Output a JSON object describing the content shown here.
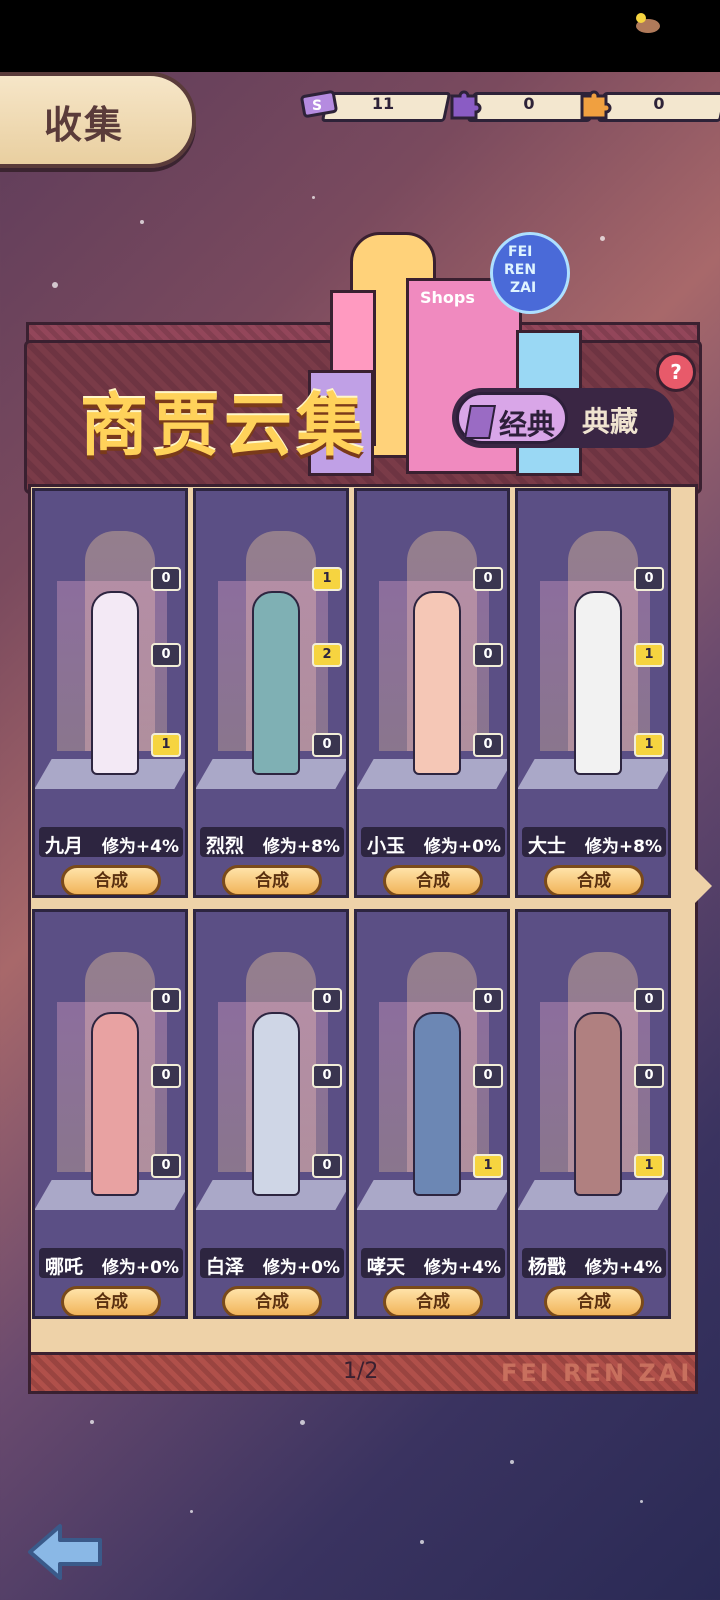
{
  "header": {
    "title": "收集",
    "currencies": [
      {
        "icon": "ticket-icon",
        "value": "11"
      },
      {
        "icon": "purple-puzzle-icon",
        "value": "0"
      },
      {
        "icon": "orange-puzzle-icon",
        "value": "0"
      }
    ]
  },
  "banner": {
    "title": "商贾云集",
    "help": "?",
    "tabs": {
      "active": "经典",
      "inactive": "典藏"
    },
    "sign_text": [
      "FEI",
      "REN",
      "ZAI"
    ],
    "shop_text": "Shops"
  },
  "cards": [
    {
      "name": "九月",
      "stat": "修为+4%",
      "badges": [
        "0",
        "0",
        "1"
      ],
      "button": "合成",
      "color": "#f3e9f5"
    },
    {
      "name": "烈烈",
      "stat": "修为+8%",
      "badges": [
        "1",
        "2",
        "0"
      ],
      "button": "合成",
      "color": "#7fb0b4"
    },
    {
      "name": "小玉",
      "stat": "修为+0%",
      "badges": [
        "0",
        "0",
        "0"
      ],
      "button": "合成",
      "color": "#f5c7b6"
    },
    {
      "name": "大士",
      "stat": "修为+8%",
      "badges": [
        "0",
        "1",
        "1"
      ],
      "button": "合成",
      "color": "#f2f2f2"
    },
    {
      "name": "哪吒",
      "stat": "修为+0%",
      "badges": [
        "0",
        "0",
        "0"
      ],
      "button": "合成",
      "color": "#e8a2a2"
    },
    {
      "name": "白泽",
      "stat": "修为+0%",
      "badges": [
        "0",
        "0",
        "0"
      ],
      "button": "合成",
      "color": "#cfd6e6"
    },
    {
      "name": "哮天",
      "stat": "修为+4%",
      "badges": [
        "0",
        "0",
        "1"
      ],
      "button": "合成",
      "color": "#6c87b4"
    },
    {
      "name": "杨戬",
      "stat": "修为+4%",
      "badges": [
        "0",
        "0",
        "1"
      ],
      "button": "合成",
      "color": "#b08080"
    }
  ],
  "pager": {
    "page": "1/2",
    "watermark": "FEI REN ZAI"
  }
}
